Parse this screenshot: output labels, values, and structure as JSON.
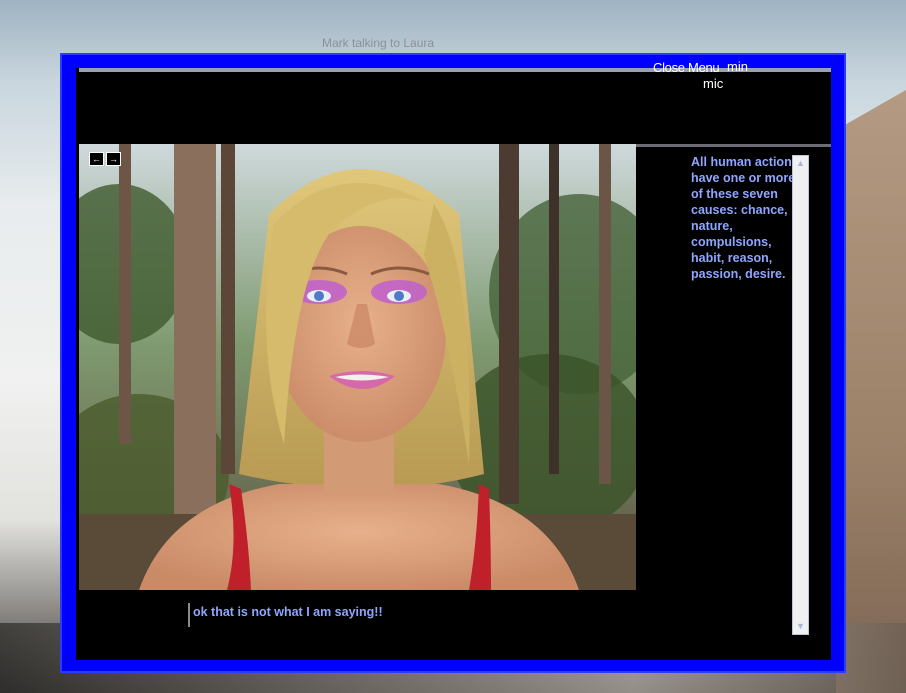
{
  "window": {
    "caption": "Mark talking to Laura"
  },
  "menu": {
    "close": "Close Menu",
    "min": "min",
    "mic": "mic"
  },
  "nav": {
    "back": "←",
    "forward": "→"
  },
  "response_text": "All human actions have one or more of these seven causes: chance, nature, compulsions, habit, reason, passion, desire.",
  "user_input": "ok that is not what I am saying!!",
  "scroll": {
    "up": "▲",
    "down": "▼"
  },
  "colors": {
    "frame": "#0000ff",
    "text_accent": "#8fa6ff",
    "background": "#000000"
  },
  "icons": {
    "avatar": "3d-woman-avatar",
    "background": "forest-scene"
  }
}
